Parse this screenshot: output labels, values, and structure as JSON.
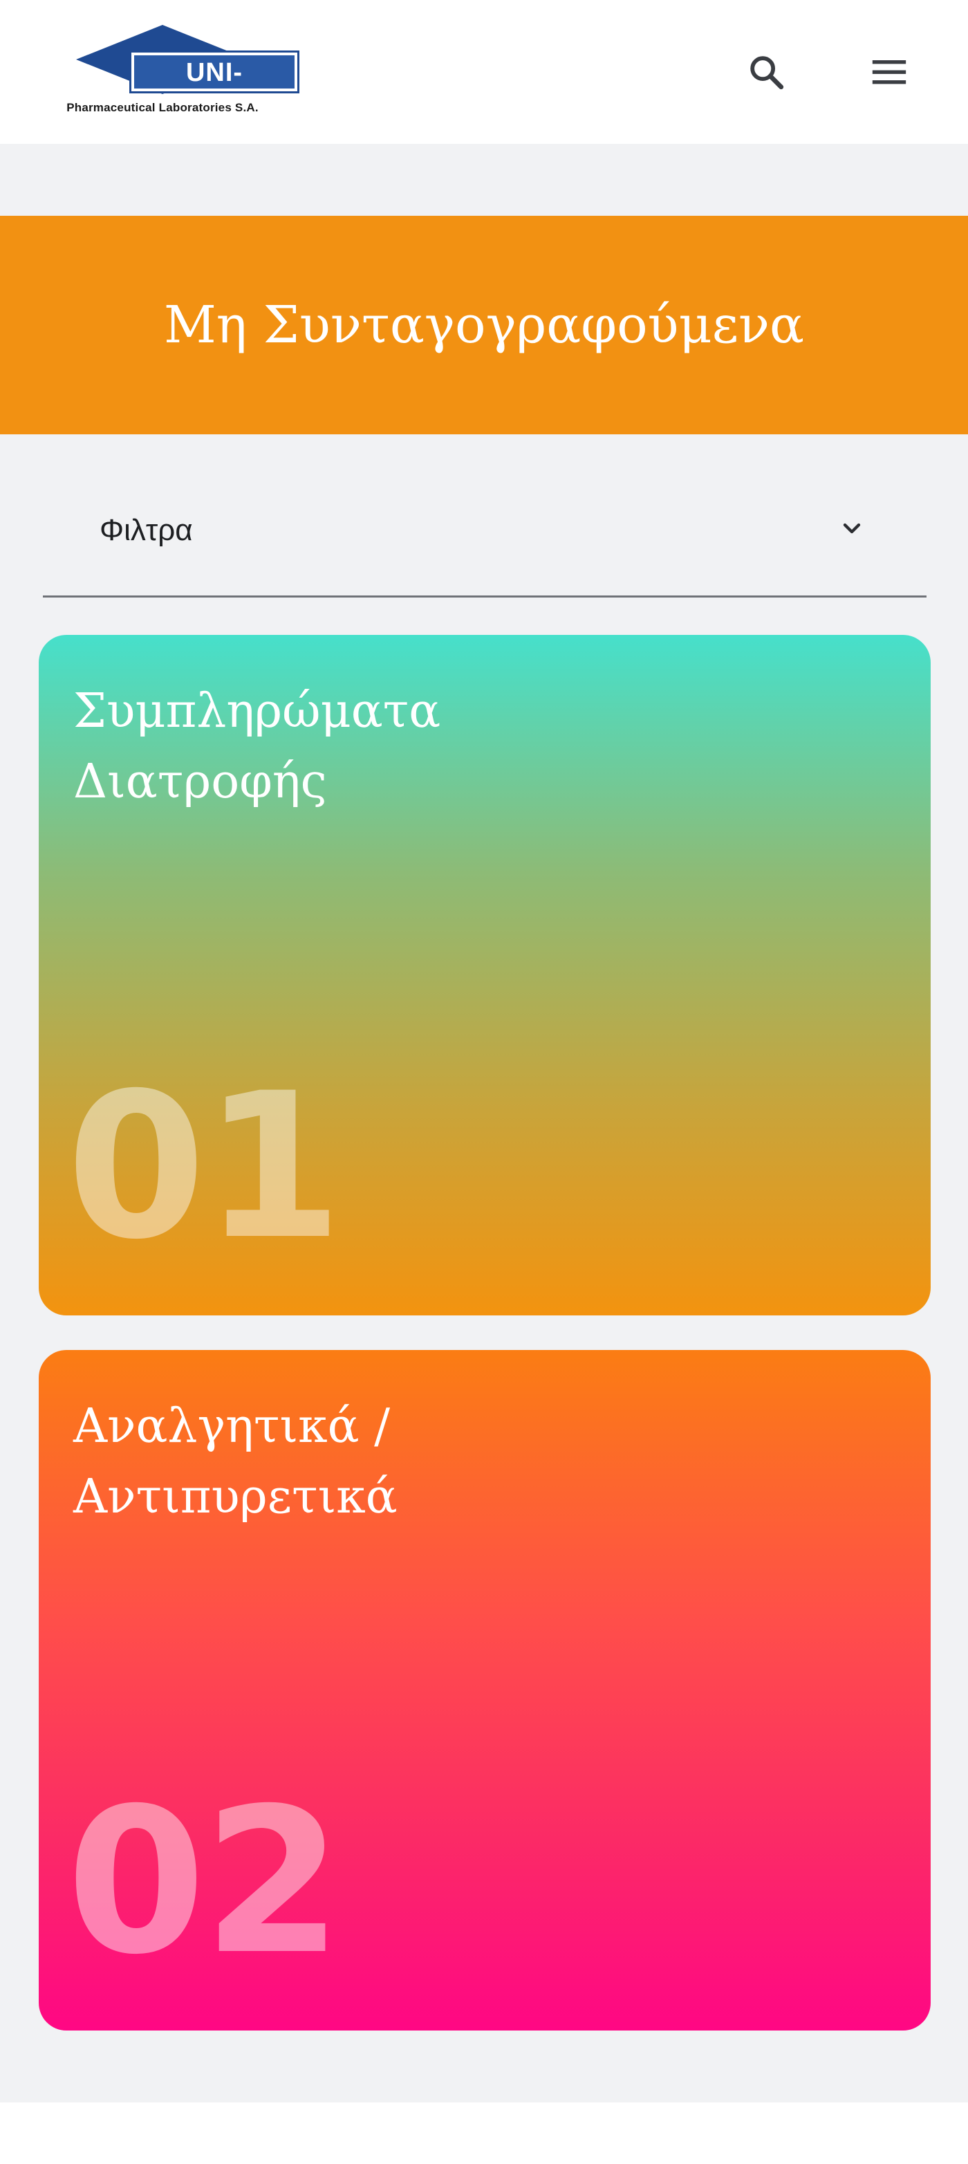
{
  "header": {
    "logo": {
      "name": "UNI-PHARMA",
      "subtitle": "Pharmaceutical Laboratories S.A.",
      "brand_color": "#2a5aa6"
    },
    "search_icon": "search-icon",
    "menu_icon": "hamburger-menu-icon"
  },
  "banner": {
    "title": "Μη Συνταγογραφούμενα",
    "color": "#f29112"
  },
  "filter": {
    "label": "Φιλτρα",
    "icon": "chevron-down-icon"
  },
  "categories": [
    {
      "title_line1": "Συμπληρώματα",
      "title_line2": "Διατροφής",
      "number": "01",
      "gradient": [
        "#46e0cb",
        "#f3930f"
      ]
    },
    {
      "title_line1": "Αναλγητικά /",
      "title_line2": "Αντιπυρετικά",
      "number": "02",
      "gradient": [
        "#fb7d13",
        "#ff0784"
      ]
    }
  ]
}
